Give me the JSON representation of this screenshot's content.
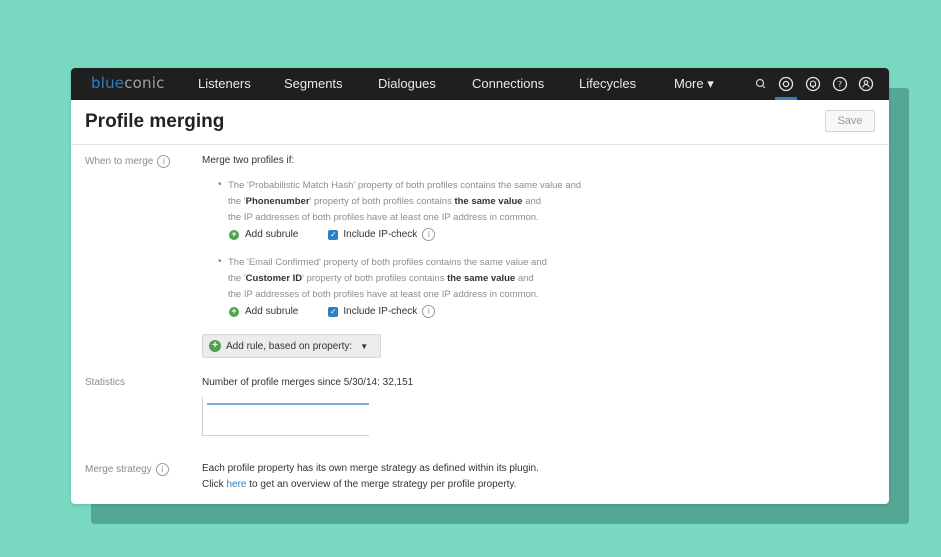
{
  "app": {
    "logo_part1": "blue",
    "logo_part2": "conic"
  },
  "nav": {
    "items": [
      "Listeners",
      "Segments",
      "Dialogues",
      "Connections",
      "Lifecycles",
      "More ▾"
    ],
    "icons": [
      "search-icon",
      "settings-icon",
      "notifications-icon",
      "help-icon",
      "user-icon"
    ]
  },
  "page": {
    "title": "Profile merging",
    "save_label": "Save"
  },
  "when_to_merge": {
    "label": "When to merge",
    "intro": "Merge two profiles if:",
    "rules": [
      {
        "line1": "The 'Probabilistic Match Hash' property of both profiles contains the same value and",
        "line2_pre": "the '",
        "line2_prop": "Phonenumber",
        "line2_mid": "' property of both profiles contains ",
        "line2_bold": "the same value",
        "line2_post": " and",
        "line3": "the IP addresses of both profiles have at least one IP address in common.",
        "add_subrule": "Add subrule",
        "include_ip": "Include IP-check",
        "ip_checked": true
      },
      {
        "line1": "The 'Email Confirmed' property of both profiles contains the same value and",
        "line2_pre": "the '",
        "line2_prop": "Customer ID",
        "line2_mid": "' property of both profiles contains ",
        "line2_bold": "the same value",
        "line2_post": " and",
        "line3": "the IP addresses of both profiles have at least one IP address in common.",
        "add_subrule": "Add subrule",
        "include_ip": "Include IP-check",
        "ip_checked": true
      }
    ],
    "add_rule_label": "Add rule, based on property:"
  },
  "statistics": {
    "label": "Statistics",
    "text": "Number of profile merges since 5/30/14: 32,151"
  },
  "merge_strategy": {
    "label": "Merge strategy",
    "line1": "Each profile property has its own merge strategy as defined within its plugin.",
    "line2_pre": "Click ",
    "line2_link": "here",
    "line2_post": " to get an overview of the merge strategy per profile property."
  },
  "colors": {
    "background": "#79d8c0",
    "navbar": "#1f1f1f",
    "accent": "#2d7fc4",
    "success": "#4fa14f"
  }
}
